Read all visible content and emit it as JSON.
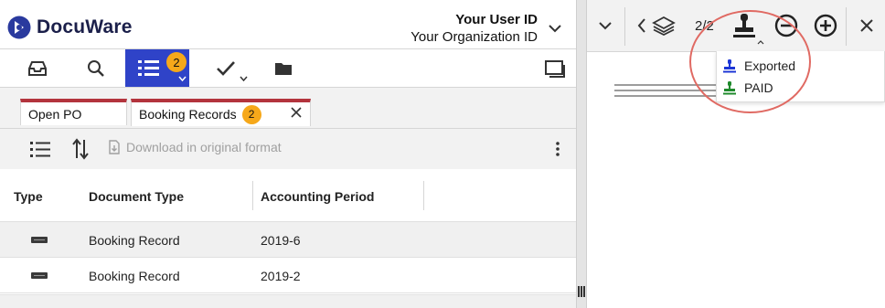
{
  "app": {
    "name": "DocuWare"
  },
  "user": {
    "id": "Your User ID",
    "organization": "Your Organization ID"
  },
  "toolbar": {
    "buttons": [
      {
        "icon": "inbox-tray-icon"
      },
      {
        "icon": "search-icon"
      },
      {
        "icon": "result-list-icon",
        "badge": "2",
        "active": true
      },
      {
        "icon": "checkmark-icon"
      },
      {
        "icon": "folder-icon"
      }
    ]
  },
  "tabs": [
    {
      "label": "Open PO"
    },
    {
      "label": "Booking Records",
      "badge": "2"
    }
  ],
  "actions": {
    "download_label": "Download in original format"
  },
  "table": {
    "columns": [
      "Type",
      "Document Type",
      "Accounting Period"
    ],
    "rows": [
      {
        "document_type": "Booking Record",
        "accounting_period": "2019-6"
      },
      {
        "document_type": "Booking Record",
        "accounting_period": "2019-2"
      }
    ]
  },
  "viewer": {
    "page_count": "2/2",
    "stamp_menu": [
      {
        "label": "Exported",
        "color": "#1c36d6"
      },
      {
        "label": "PAID",
        "color": "#1f8a2c"
      }
    ]
  },
  "colors": {
    "accent": "#2f43c8",
    "badge": "#f6a81a",
    "tab_marker": "#b3343d",
    "highlight": "#e06a63"
  }
}
